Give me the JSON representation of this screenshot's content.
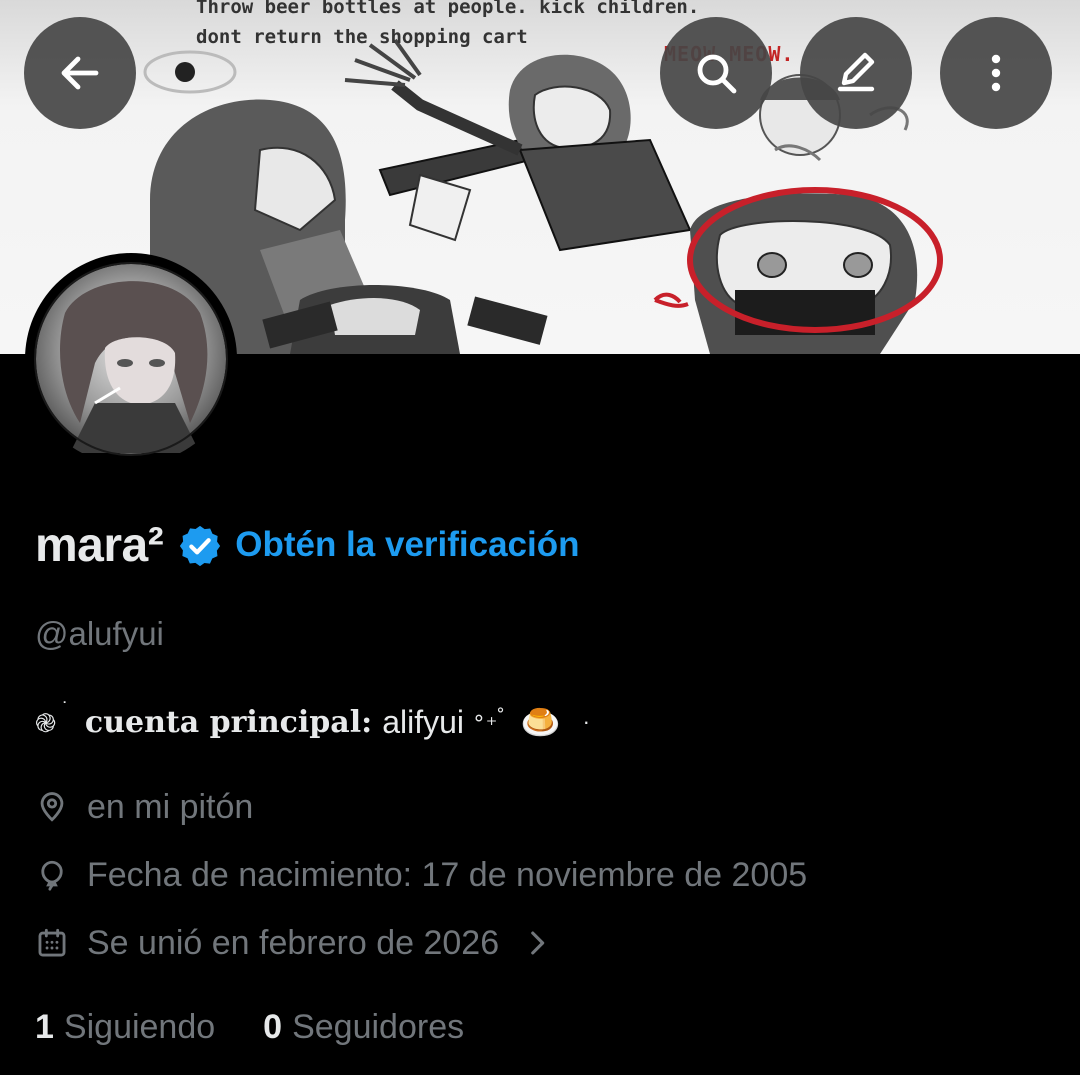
{
  "banner": {
    "caption_line1": "Throw beer bottles at people. kick children.",
    "caption_line2": "dont return the shopping cart",
    "caption_meow": "MEOW MEOW."
  },
  "top_bar": {
    "icons": [
      "back-arrow-icon",
      "search-icon",
      "edit-pencil-icon",
      "more-vertical-icon"
    ]
  },
  "profile": {
    "display_name": "mara²",
    "get_verified": "Obtén la verificación",
    "handle": "@alufyui",
    "bio": {
      "spiral": "֎",
      "dot_a": "˙",
      "bold": "cuenta principal:",
      "account": "alifyui",
      "sparkle": "∘₊˚",
      "flan": "🍮",
      "dot_b": "·"
    },
    "location": "en mi pitón",
    "birthdate": "Fecha de nacimiento: 17 de noviembre de 2005",
    "joined": "Se unió en febrero de 2026",
    "following_count": "1",
    "following_label": "Siguiendo",
    "followers_count": "0",
    "followers_label": "Seguidores"
  },
  "colors": {
    "background": "#000000",
    "text_primary": "#e7e9ea",
    "text_secondary": "#71767b",
    "accent": "#1d9bf0",
    "top_button": "#464646"
  }
}
